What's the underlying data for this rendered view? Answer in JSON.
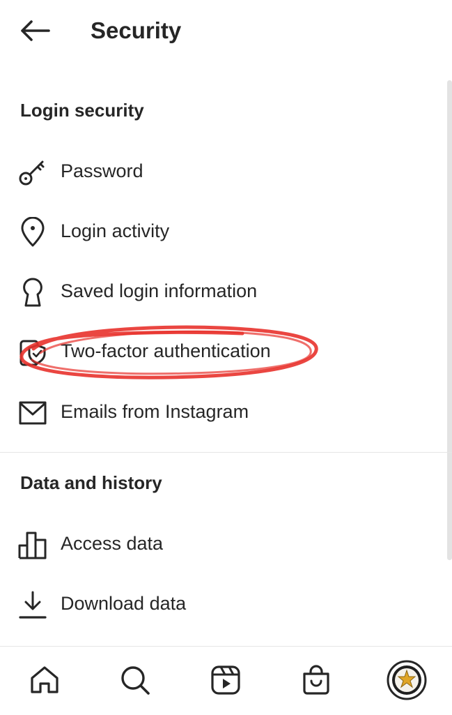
{
  "header": {
    "title": "Security",
    "back_icon": "arrow-left-icon"
  },
  "sections": {
    "login": {
      "title": "Login security",
      "items": [
        {
          "label": "Password",
          "icon": "key-icon"
        },
        {
          "label": "Login activity",
          "icon": "location-pin-icon"
        },
        {
          "label": "Saved login information",
          "icon": "keyhole-icon"
        },
        {
          "label": "Two-factor authentication",
          "icon": "shield-phone-icon"
        },
        {
          "label": "Emails from Instagram",
          "icon": "envelope-icon"
        }
      ]
    },
    "data": {
      "title": "Data and history",
      "items": [
        {
          "label": "Access data",
          "icon": "bar-chart-icon"
        },
        {
          "label": "Download data",
          "icon": "download-icon"
        }
      ]
    }
  },
  "bottom_nav": [
    "home-icon",
    "search-icon",
    "reels-icon",
    "shop-icon",
    "profile-avatar"
  ],
  "annotation": {
    "color": "#e8322c",
    "target": "Two-factor authentication"
  }
}
